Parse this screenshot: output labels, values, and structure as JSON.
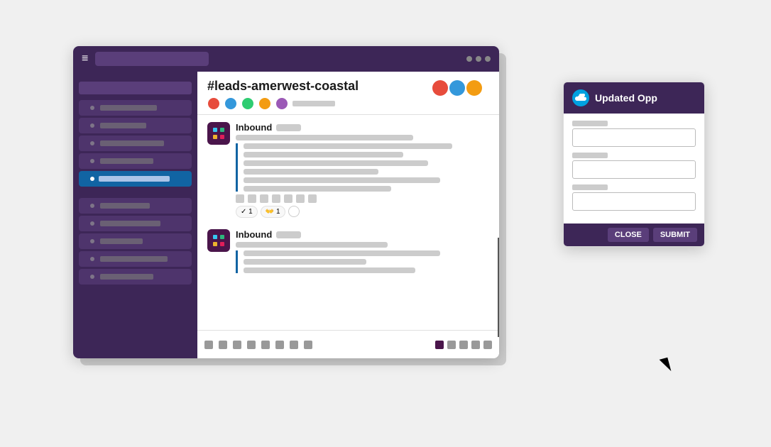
{
  "title_bar": {
    "menu_icon": "≡",
    "dots": [
      "dot1",
      "dot2",
      "dot3"
    ]
  },
  "channel": {
    "name": "#leads-amerwest-coastal",
    "meta_text": ""
  },
  "messages": [
    {
      "sender": "Inbound",
      "badge": "",
      "lines": [
        5,
        4,
        5,
        3,
        4,
        3,
        5
      ],
      "reactions": [
        "1",
        "1"
      ],
      "has_quoted": true
    },
    {
      "sender": "Inbound",
      "badge": "",
      "lines": [
        4,
        3,
        4
      ],
      "has_quoted": true
    }
  ],
  "sf_modal": {
    "title": "Updated Opp",
    "cloud_icon": "☁",
    "field_labels": [
      "label1",
      "label2",
      "label3"
    ],
    "buttons": {
      "close": "CLOSE",
      "submit": "SUBMIT"
    }
  },
  "sidebar": {
    "items": [
      {
        "active": false
      },
      {
        "active": false
      },
      {
        "active": false
      },
      {
        "active": false
      },
      {
        "active": true
      },
      {
        "active": false
      },
      {
        "active": false
      },
      {
        "active": false
      },
      {
        "active": false
      },
      {
        "active": false
      },
      {
        "active": false
      }
    ]
  }
}
